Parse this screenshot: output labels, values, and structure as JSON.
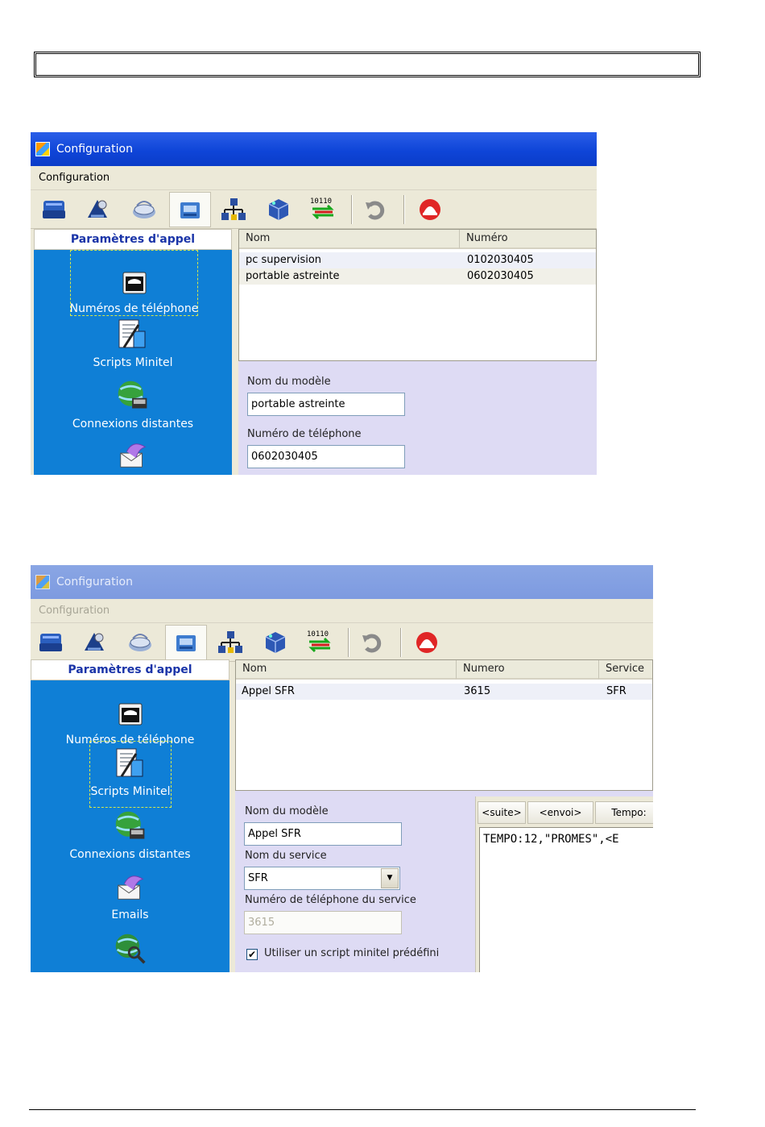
{
  "window1": {
    "title": "Configuration",
    "menu": "Configuration",
    "toolbar_icons": [
      "printer-icon",
      "wizard-icon",
      "modem-icon",
      "phone-settings-icon",
      "network-icon",
      "cube-icon",
      "data-transfer-icon",
      "undo-icon",
      "alarm-icon"
    ],
    "toolbar_transfer_label": "10110",
    "sidebar": {
      "header": "Paramètres d'appel",
      "items": [
        "Numéros de téléphone",
        "Scripts Minitel",
        "Connexions distantes"
      ]
    },
    "list": {
      "columns": [
        "Nom",
        "Numéro"
      ],
      "rows": [
        {
          "nom": "pc supervision",
          "numero": "0102030405"
        },
        {
          "nom": "portable astreinte",
          "numero": "0602030405"
        }
      ]
    },
    "form": {
      "model_label": "Nom du modèle",
      "model_value": "portable astreinte",
      "phone_label": "Numéro de téléphone",
      "phone_value": "0602030405"
    }
  },
  "window2": {
    "title": "Configuration",
    "menu": "Configuration",
    "toolbar_transfer_label": "10110",
    "sidebar": {
      "header": "Paramètres d'appel",
      "items": [
        "Numéros de téléphone",
        "Scripts Minitel",
        "Connexions distantes",
        "Emails"
      ]
    },
    "list": {
      "columns": [
        "Nom",
        "Numero",
        "Service"
      ],
      "rows": [
        {
          "nom": "Appel SFR",
          "numero": "3615",
          "service": "SFR"
        }
      ]
    },
    "form": {
      "model_label": "Nom du modèle",
      "model_value": "Appel SFR",
      "service_label": "Nom du service",
      "service_value": "SFR",
      "service_phone_label": "Numéro de téléphone du service",
      "service_phone_value": "3615",
      "checkbox_label": "Utiliser un script minitel prédéfini",
      "checkbox_checked": true
    },
    "script": {
      "tabs": [
        "<suite>",
        "<envoi>",
        "Tempo:"
      ],
      "text": "TEMPO:12,\"PROMES\",<E"
    }
  }
}
